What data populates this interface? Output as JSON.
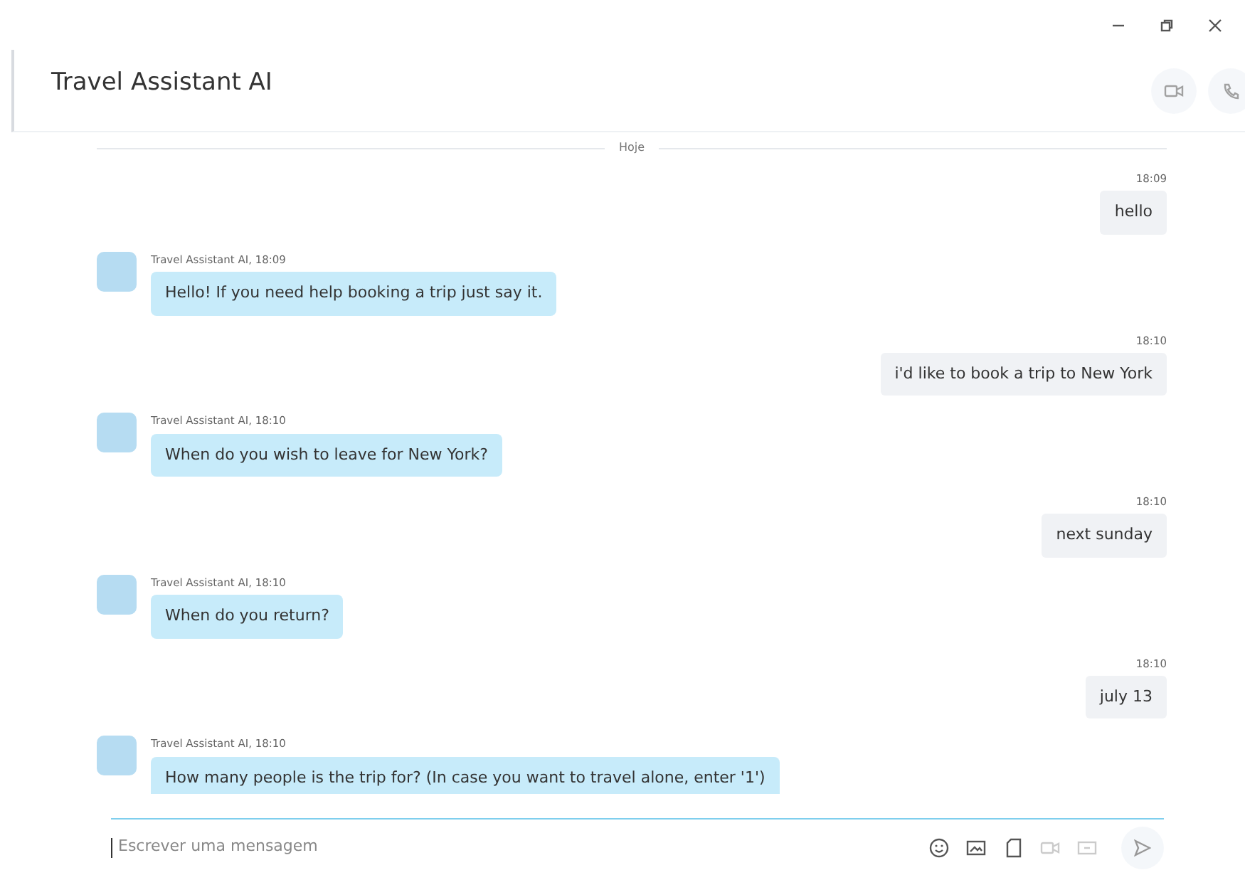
{
  "window": {
    "controls": [
      {
        "kind": "minimize"
      },
      {
        "kind": "restore"
      },
      {
        "kind": "close"
      }
    ]
  },
  "header": {
    "title": "Travel Assistant AI",
    "actions": [
      {
        "kind": "video",
        "disabled": true
      },
      {
        "kind": "phone",
        "disabled": true
      }
    ]
  },
  "day_separator": "Hoje",
  "messages": [
    {
      "kind": "outgoing",
      "meta": "18:09",
      "text": "hello"
    },
    {
      "kind": "incoming",
      "meta": "Travel Assistant AI, 18:09",
      "text": "Hello! If you need help booking a trip just say it."
    },
    {
      "kind": "outgoing",
      "meta": "18:10",
      "text": "i'd like to book a trip to New York"
    },
    {
      "kind": "incoming",
      "meta": "Travel Assistant AI, 18:10",
      "text": "When do you wish to leave for New York?"
    },
    {
      "kind": "outgoing",
      "meta": "18:10",
      "text": "next sunday"
    },
    {
      "kind": "incoming",
      "meta": "Travel Assistant AI, 18:10",
      "text": "When do you return?"
    },
    {
      "kind": "outgoing",
      "meta": "18:10",
      "text": "july 13"
    },
    {
      "kind": "incoming",
      "meta": "Travel Assistant AI, 18:10",
      "text": "How many people is the trip for? (In case you want to travel alone, enter '1')"
    }
  ],
  "composer": {
    "placeholder": "Escrever uma mensagem",
    "tools": [
      {
        "kind": "emoji",
        "disabled": false
      },
      {
        "kind": "image",
        "disabled": false
      },
      {
        "kind": "file",
        "disabled": false
      },
      {
        "kind": "video",
        "disabled": true
      },
      {
        "kind": "screen",
        "disabled": true
      },
      {
        "kind": "send",
        "disabled": true
      }
    ]
  }
}
